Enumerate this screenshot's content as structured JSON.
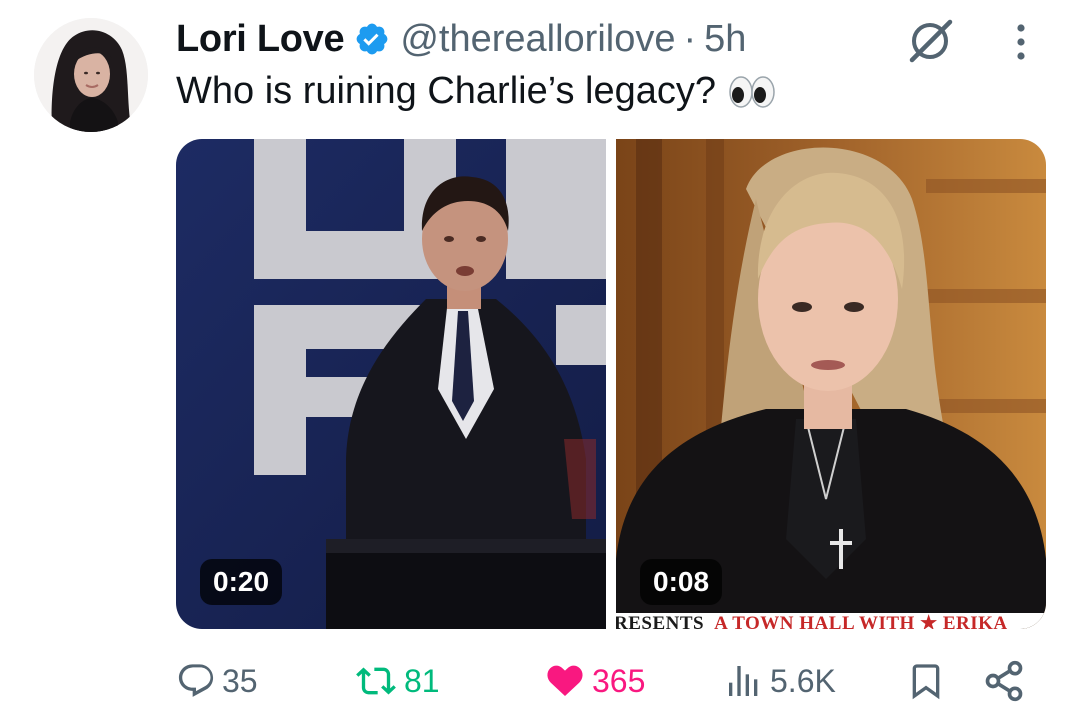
{
  "author": {
    "name": "Lori Love",
    "handle": "@thereallorilove",
    "separator": "·",
    "time": "5h"
  },
  "post": {
    "text": "Who is ruining Charlie’s legacy?"
  },
  "media": [
    {
      "duration": "0:20"
    },
    {
      "duration": "0:08",
      "banner_left": "RESENTS",
      "banner_right": "A TOWN HALL WITH ★ ERIKA"
    }
  ],
  "actions": {
    "replies": "35",
    "reposts": "81",
    "likes": "365",
    "views": "5.6K"
  },
  "colors": {
    "verified": "#1d9bf0",
    "repost": "#00ba7c",
    "like": "#f91880",
    "muted": "#536471"
  },
  "icons": [
    "verified-badge-icon",
    "grok-icon",
    "more-icon",
    "reply-icon",
    "repost-icon",
    "like-icon",
    "views-icon",
    "bookmark-icon",
    "share-icon",
    "eyes-emoji"
  ]
}
